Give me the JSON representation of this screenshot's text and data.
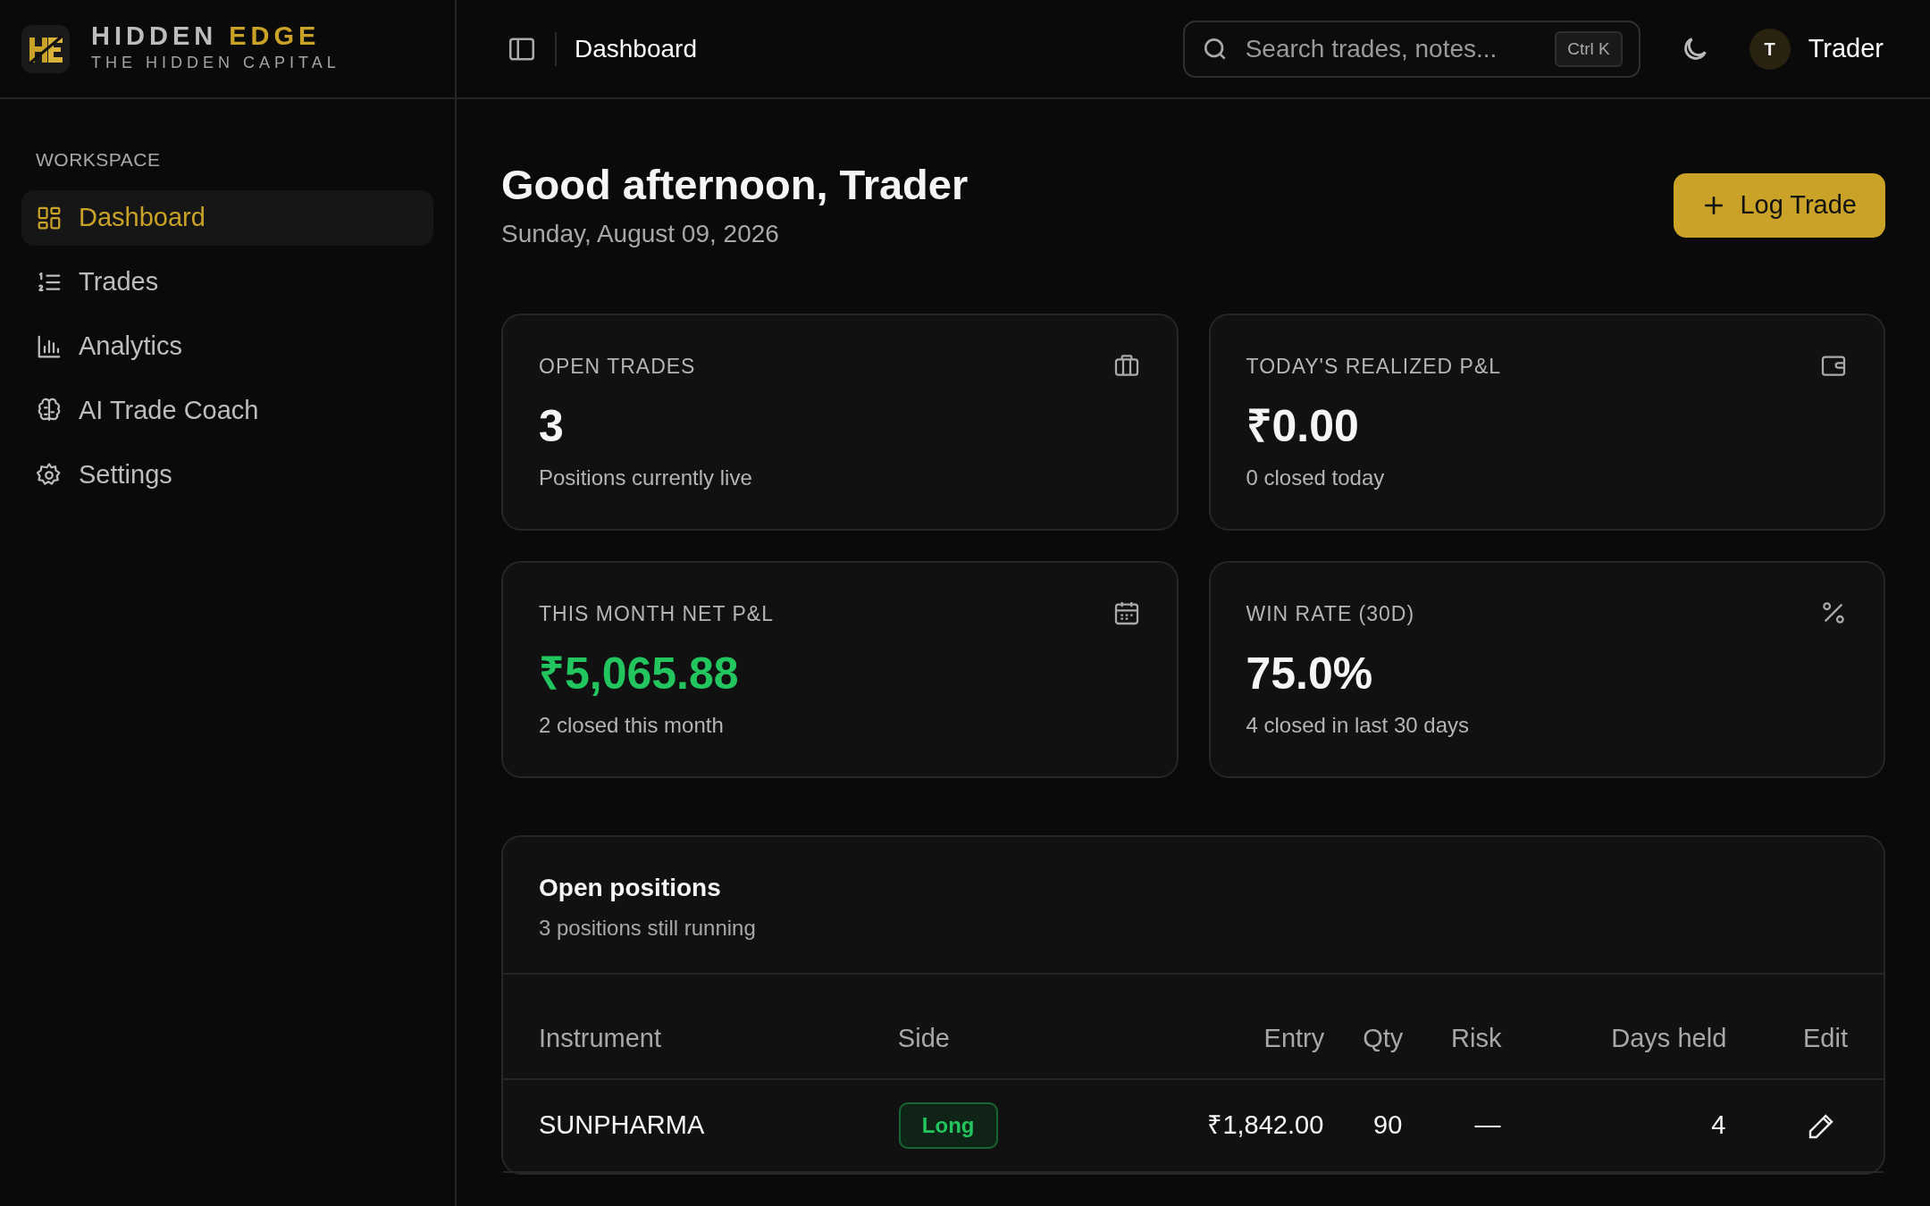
{
  "brand": {
    "name_main": "HIDDEN",
    "name_accent": "EDGE",
    "tagline": "THE HIDDEN CAPITAL"
  },
  "sidebar": {
    "section": "WORKSPACE",
    "items": [
      {
        "label": "Dashboard",
        "selected": true
      },
      {
        "label": "Trades",
        "selected": false
      },
      {
        "label": "Analytics",
        "selected": false
      },
      {
        "label": "AI Trade Coach",
        "selected": false
      },
      {
        "label": "Settings",
        "selected": false
      }
    ]
  },
  "topbar": {
    "page_title": "Dashboard",
    "search": {
      "placeholder": "Search trades, notes...",
      "shortcut": "Ctrl K"
    },
    "avatar": "T",
    "user": "Trader"
  },
  "header": {
    "greeting": "Good afternoon, Trader",
    "date": "Sunday, August 09, 2026",
    "action": "Log Trade"
  },
  "stats": [
    {
      "label": "OPEN TRADES",
      "value": "3",
      "note": "Positions currently live",
      "color": "#f5f5f5"
    },
    {
      "label": "TODAY'S REALIZED P&L",
      "value": "₹0.00",
      "note": "0 closed today",
      "color": "#f5f5f5"
    },
    {
      "label": "THIS MONTH NET P&L",
      "value": "₹5,065.88",
      "note": "2 closed this month",
      "color": "#22c55e"
    },
    {
      "label": "WIN RATE (30D)",
      "value": "75.0%",
      "note": "4 closed in last 30 days",
      "color": "#f5f5f5"
    }
  ],
  "positions": {
    "title": "Open positions",
    "subtitle": "3 positions still running",
    "columns": [
      "Instrument",
      "Side",
      "Entry",
      "Qty",
      "Risk",
      "Days held",
      "Edit"
    ],
    "rows": [
      {
        "instrument": "SUNPHARMA",
        "side": "Long",
        "kind": "long",
        "entry": "₹1,842.00",
        "qty": "90",
        "risk": "—",
        "days_held": "4"
      }
    ]
  }
}
